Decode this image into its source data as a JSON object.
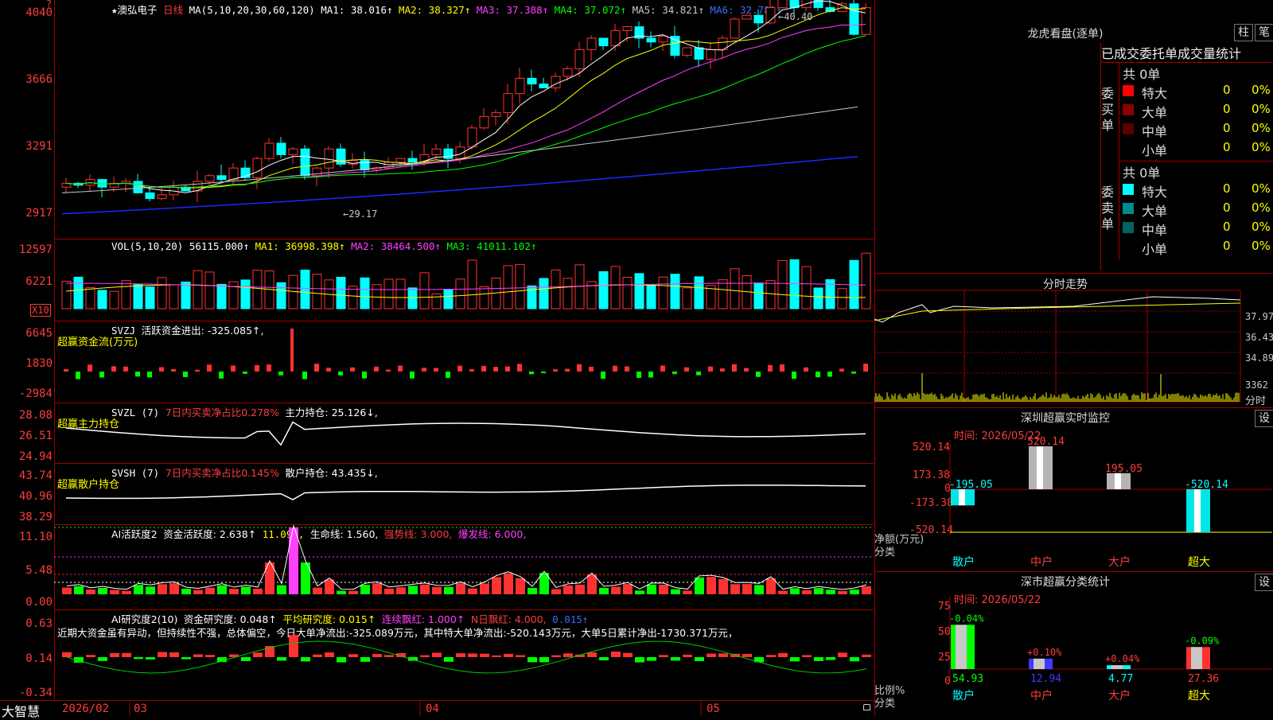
{
  "main": {
    "star": "★",
    "stock_name": "澳弘电子",
    "period": "日线",
    "ma_label": "MA(5,10,20,30,60,120)",
    "ma1": "MA1: 38.016↑",
    "ma2": "MA2: 38.327↑",
    "ma3": "MA3: 37.388↑",
    "ma4": "MA4: 37.072↑",
    "ma5": "MA5: 34.821↑",
    "ma6": "MA6: 32.781↑",
    "y_ticks": [
      "4040",
      "3666",
      "3291",
      "2917"
    ],
    "high_label": "←40.40",
    "low_label": "←29.17",
    "question_mark": "?"
  },
  "volume": {
    "header": "VOL(5,10,20)",
    "vol": "56115.000↑",
    "ma1": "MA1: 36998.398↑",
    "ma2": "MA2: 38464.500↑",
    "ma3": "MA3: 41011.102↑",
    "y_ticks": [
      "12597",
      "6221"
    ],
    "unit_box": "X10"
  },
  "svzj": {
    "header": "SVZJ",
    "line": "活跃资金进出: -325.085↑,",
    "sub": "超赢资金流(万元)",
    "y_ticks": [
      "6645",
      "1830",
      "-2984"
    ]
  },
  "svzl": {
    "header": "SVZL (7)",
    "ratio": "7日内买卖净占比0.278%",
    "hold": "主力持仓: 25.126↓,",
    "sub": "超赢主力持仓",
    "y_ticks": [
      "28.08",
      "26.51",
      "24.94"
    ]
  },
  "svsh": {
    "header": "SVSH (7)",
    "ratio": "7日内买卖净占比0.145%",
    "hold": "散户持仓: 43.435↓,",
    "sub": "超赢散户持仓",
    "y_ticks": [
      "43.74",
      "40.96",
      "38.29"
    ]
  },
  "ai_active": {
    "header": "AI活跃度2",
    "val": "资金活跃度: 2.638↑",
    "v2": "11.095,",
    "life": "生命线: 1.560,",
    "strong": "强势线: 3.000,",
    "burst": "爆发线: 6.000,",
    "y_ticks": [
      "11.10",
      "5.48",
      "0.00"
    ]
  },
  "ai_research": {
    "header": "AI研究度2(10)",
    "fund": "资金研究度: 0.048↑",
    "avg": "平均研究度: 0.015↑",
    "cont": "连续飘红: 1.000↑",
    "nday": "N日飘红: 4.000,",
    "tail": "0.015↑",
    "y_ticks": [
      "0.63",
      "0.14",
      "-0.34"
    ],
    "commentary": "近期大资金虽有异动，但持续性不强，总体偏空，今日大单净流出:-325.089万元，其中特大单净流出:-520.143万元，大单5日累计净出-1730.371万元，"
  },
  "time_axis": {
    "logo": "大智慧",
    "labels": [
      "2026/02",
      "03",
      "04",
      "05"
    ]
  },
  "dragon": {
    "title": "龙虎看盘(逐单)",
    "btn1": "柱",
    "btn2": "笔",
    "tabs": "已成交委托单成交量统计",
    "buy_label": "委买单",
    "sell_label": "委卖单",
    "buy_total": "共 0单",
    "sell_total": "共 0单",
    "buy_rows": [
      {
        "name": "特大",
        "val": "0",
        "pct": "0%",
        "color": "#ff0000"
      },
      {
        "name": "大单",
        "val": "0",
        "pct": "0%",
        "color": "#8c0000"
      },
      {
        "name": "中单",
        "val": "0",
        "pct": "0%",
        "color": "#5a0000"
      },
      {
        "name": "小单",
        "val": "0",
        "pct": "0%",
        "color": "#000000"
      }
    ],
    "sell_rows": [
      {
        "name": "特大",
        "val": "0",
        "pct": "0%",
        "color": "#00ffff"
      },
      {
        "name": "大单",
        "val": "0",
        "pct": "0%",
        "color": "#008c8c"
      },
      {
        "name": "中单",
        "val": "0",
        "pct": "0%",
        "color": "#006464"
      },
      {
        "name": "小单",
        "val": "0",
        "pct": "0%",
        "color": "#000000"
      }
    ]
  },
  "intraday": {
    "title": "分时走势",
    "y_ticks": [
      "37.97",
      "36.43",
      "34.89"
    ],
    "vol_label": "3362",
    "footer": "分时"
  },
  "sz_monitor": {
    "title": "深圳超赢实时监控",
    "set": "设",
    "time": "时间: 2026/05/22",
    "y_ticks": [
      "520.14",
      "173.38",
      "0",
      "-173.38",
      "-520.14"
    ],
    "ylabel": "净额(万元)",
    "xlabel": "分类",
    "categories": [
      "散户",
      "中户",
      "大户",
      "超大"
    ],
    "values": [
      -195.05,
      520.14,
      195.05,
      -520.14
    ],
    "value_labels": [
      "-195.05",
      "520.14",
      "195.05",
      "-520.14"
    ]
  },
  "sz_class": {
    "title": "深市超赢分类统计",
    "set": "设",
    "time": "时间: 2026/05/22",
    "y_ticks": [
      "75",
      "50",
      "25",
      "0"
    ],
    "ylabel": "比例%",
    "xlabel": "分类",
    "categories": [
      "散户",
      "中户",
      "大户",
      "超大"
    ],
    "values": [
      54.93,
      12.94,
      4.77,
      27.36
    ],
    "bottom_labels": [
      "54.93",
      "12.94",
      "4.77",
      "27.36"
    ],
    "change_labels": [
      "-0.04%",
      "+0.10%",
      "+0.04%",
      "-0.09%"
    ]
  },
  "chart_data": [
    {
      "type": "bar",
      "title": "深圳超赢实时监控",
      "ylabel": "净额(万元)",
      "xlabel": "分类",
      "categories": [
        "散户",
        "中户",
        "大户",
        "超大"
      ],
      "values": [
        -195.05,
        520.14,
        195.05,
        -520.14
      ],
      "ylim": [
        -520.14,
        520.14
      ]
    },
    {
      "type": "bar",
      "title": "深市超赢分类统计",
      "ylabel": "比例%",
      "xlabel": "分类",
      "categories": [
        "散户",
        "中户",
        "大户",
        "超大"
      ],
      "values": [
        54.93,
        12.94,
        4.77,
        27.36
      ],
      "ylim": [
        0,
        75
      ]
    }
  ]
}
